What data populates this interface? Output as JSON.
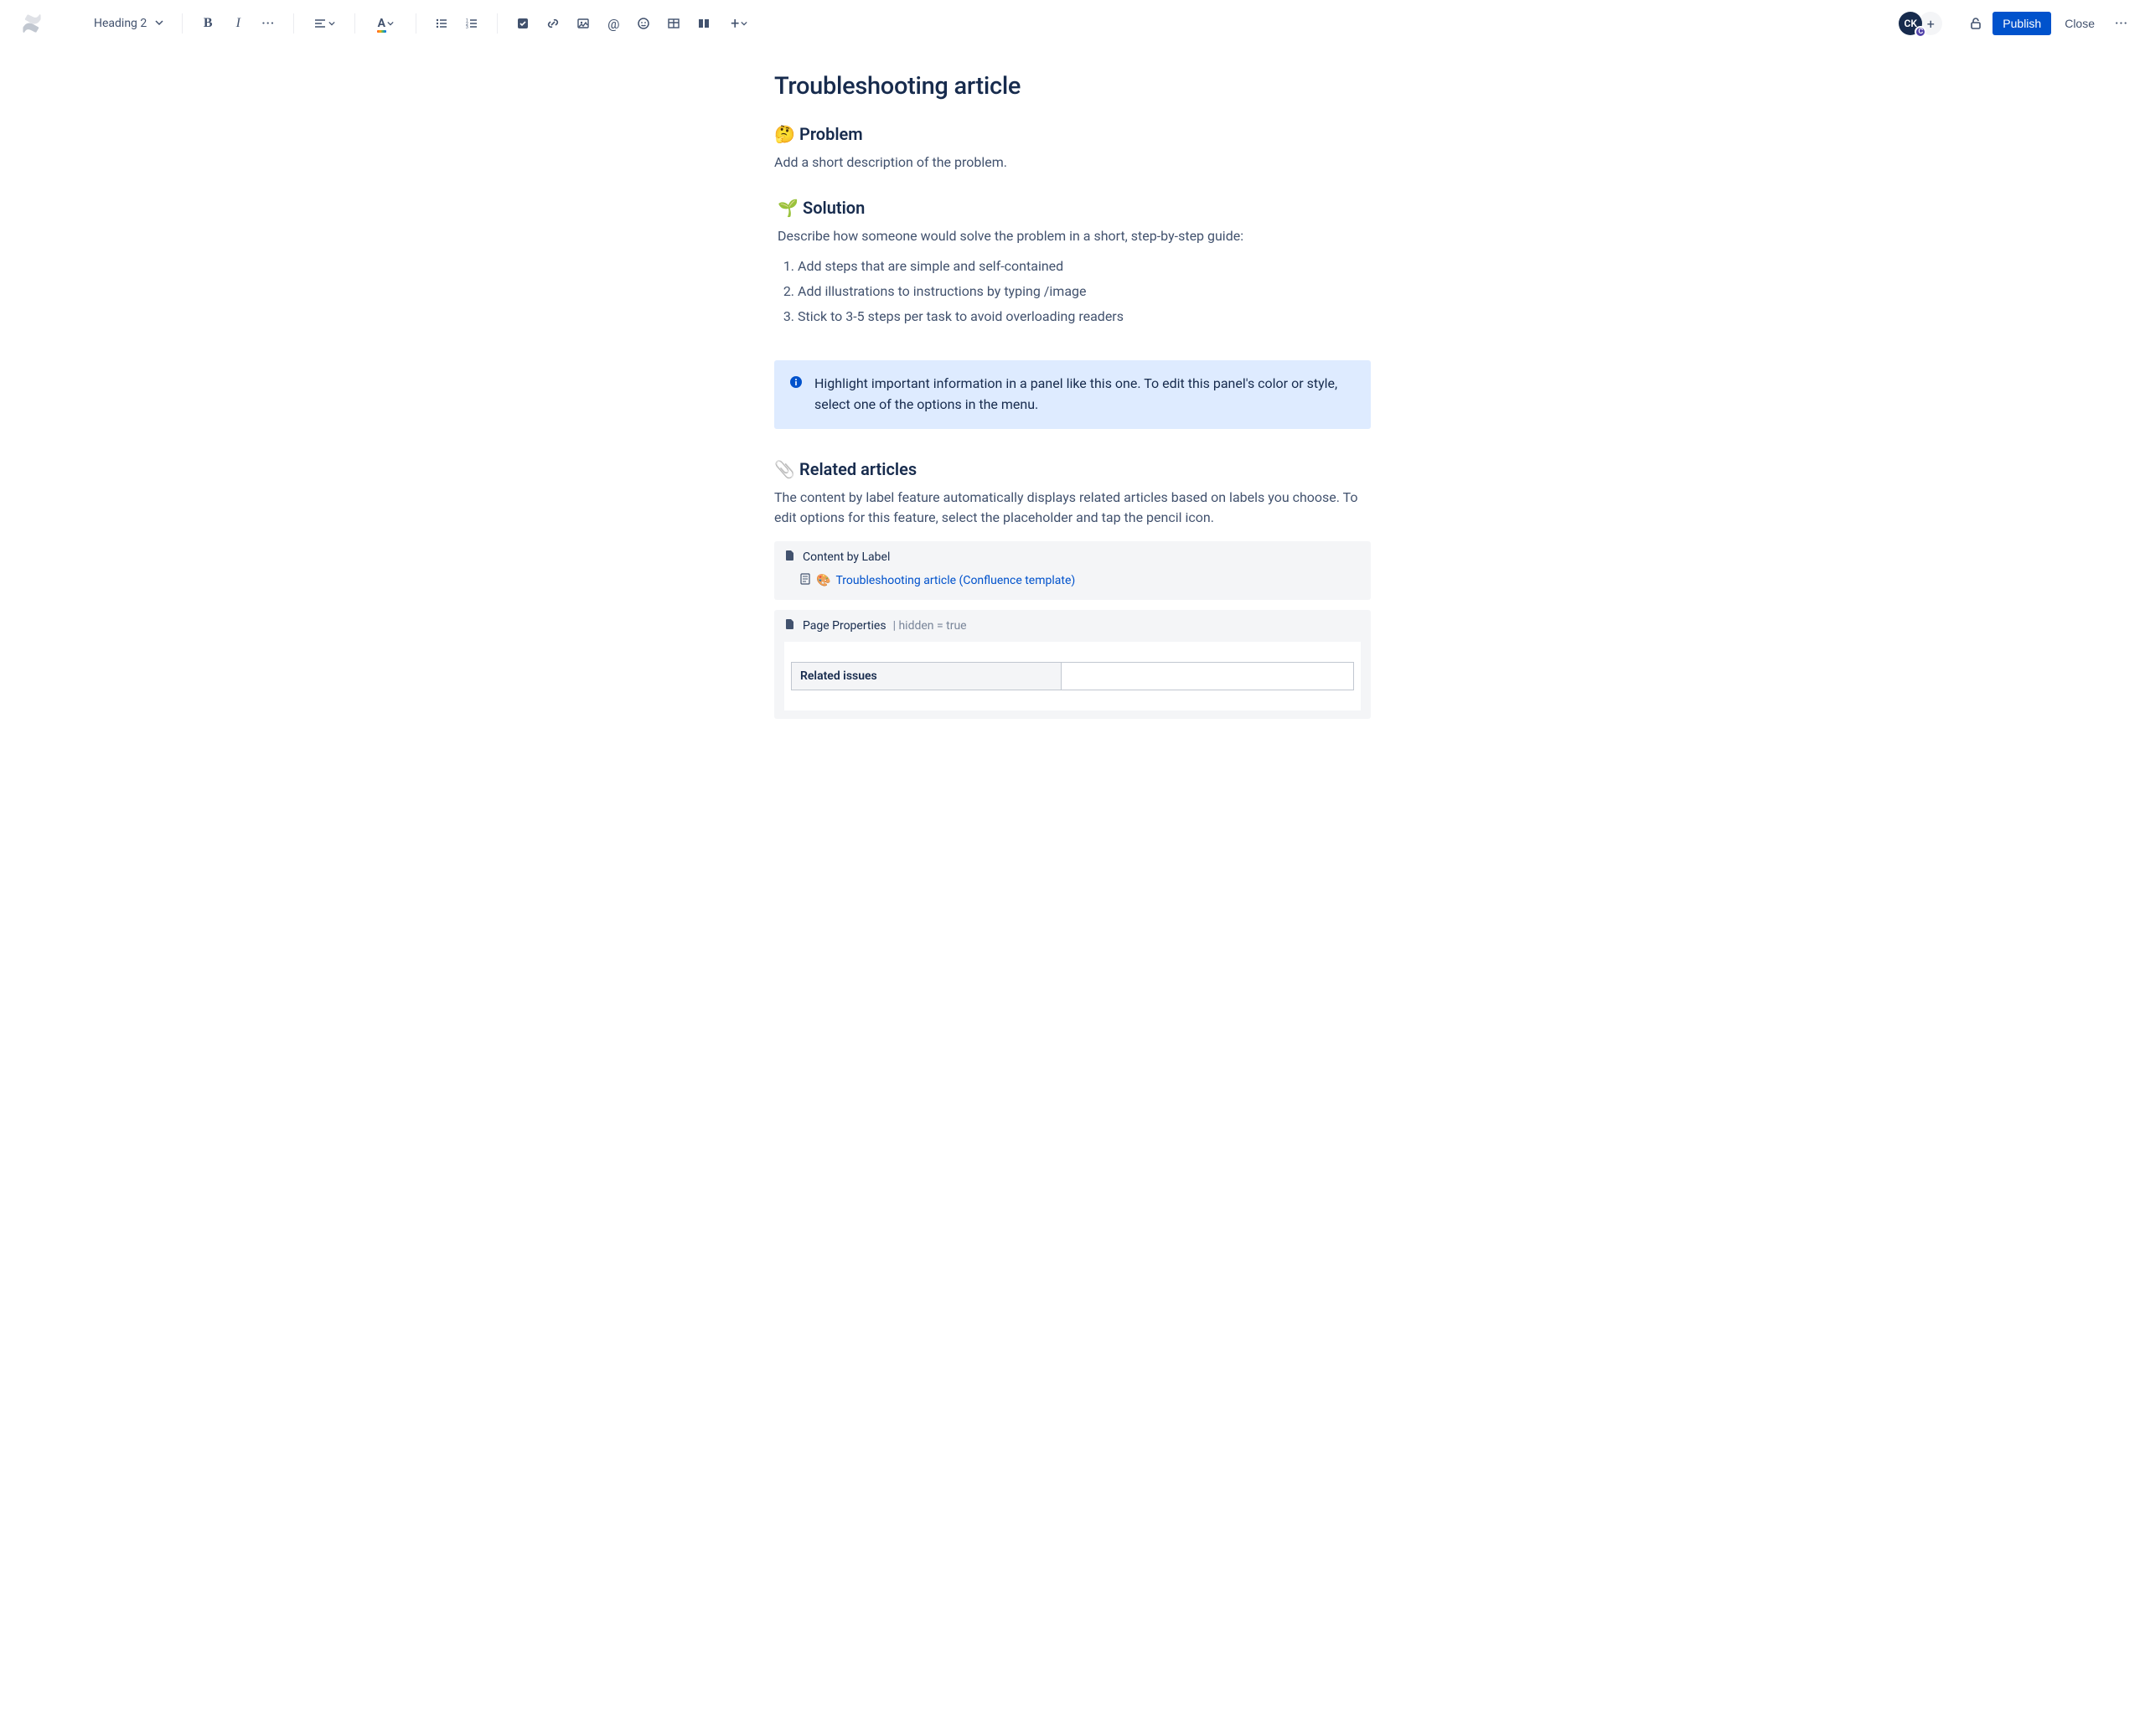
{
  "toolbar": {
    "text_style": "Heading 2",
    "avatar_initials": "CK",
    "avatar_badge": "C",
    "publish_label": "Publish",
    "close_label": "Close"
  },
  "page": {
    "title": "Troubleshooting article",
    "problem": {
      "emoji": "🤔",
      "heading": "Problem",
      "text": "Add a short description of the problem."
    },
    "solution": {
      "emoji": "🌱",
      "heading": "Solution",
      "intro": "Describe how someone would solve the problem in a short, step-by-step guide:",
      "steps": [
        "Add steps that are simple and self-contained",
        "Add illustrations to instructions by typing /image",
        "Stick to 3-5 steps per task to avoid overloading readers"
      ]
    },
    "panel": {
      "text": "Highlight important information in a panel like this one. To edit this panel's color or style, select one of the options in the menu."
    },
    "related": {
      "emoji": "📎",
      "heading": "Related articles",
      "text": "The content by label feature automatically displays related articles based on labels you choose. To edit options for this feature, select the placeholder and tap the pencil icon."
    },
    "content_by_label": {
      "macro_title": "Content by Label",
      "item_emoji": "🎨",
      "item_text": "Troubleshooting article (Confluence template)"
    },
    "page_properties": {
      "macro_title": "Page Properties",
      "suffix": " | hidden = true",
      "cell_header": "Related issues",
      "cell_value": ""
    }
  }
}
